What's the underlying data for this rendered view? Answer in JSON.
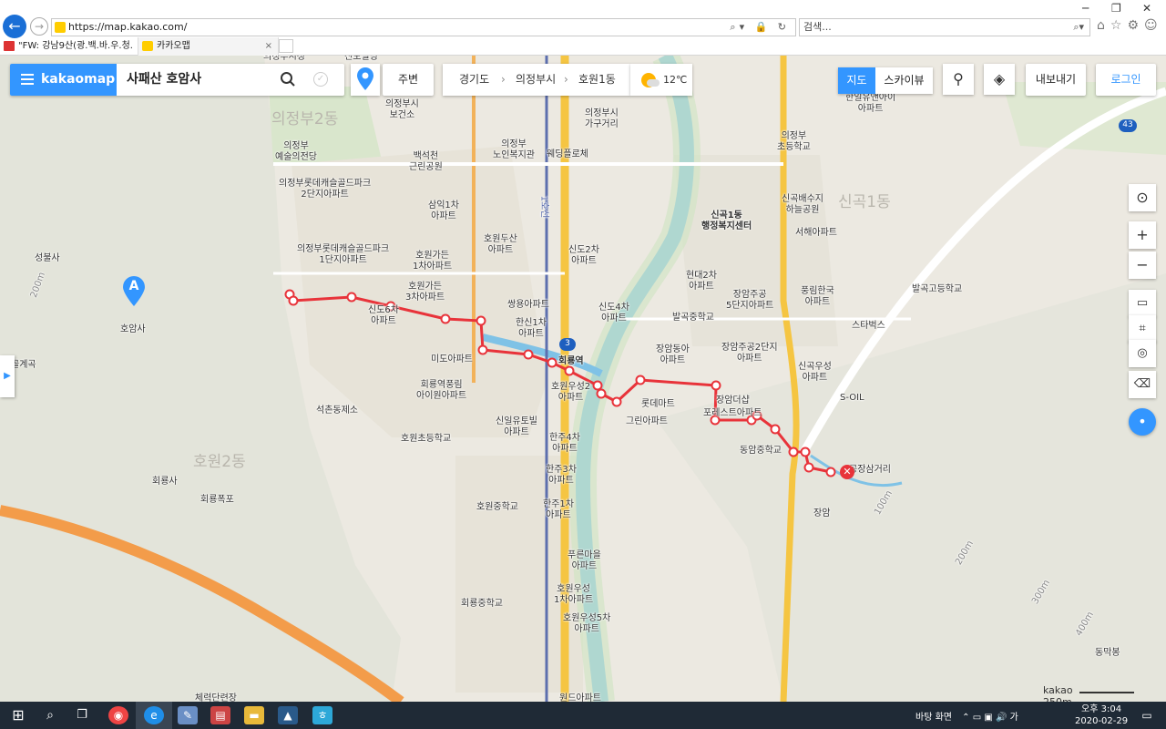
{
  "browser": {
    "url": "https://map.kakao.com/",
    "search_placeholder": "검색...",
    "tabs": [
      {
        "label": "\"FW: 강남9산(광.백.바.우.청.우..."
      },
      {
        "label": "카카오맵"
      }
    ],
    "window_controls": [
      "─",
      "❐",
      "✕"
    ]
  },
  "kakaomap": {
    "logo": "kakaomap",
    "query": "사패산 호암사",
    "nearby_button": "주변",
    "breadcrumb": [
      "경기도",
      "의정부시",
      "호원1동"
    ],
    "weather_temp": "12℃",
    "map_type": {
      "selected": "지도",
      "other": "스카이뷰"
    },
    "export_button": "내보내기",
    "login_button": "로그인",
    "start_marker": "A",
    "scale_brand": "kakao",
    "scale_distance": "250m"
  },
  "map_labels": {
    "uijeongbu_station": "의정부시청",
    "sindo_building": "신도빌딩",
    "uijeongbu_2dong": "의정부2동",
    "health_center": "의정부시\n보건소",
    "arts_hall": "의정부\n예술의전당",
    "baekseok_park": "백석천\n근린공원",
    "senior_center": "의정부\n노인복지관",
    "wedding_hall": "웨딩플로체",
    "furniture_street": "의정부시\n가구거리",
    "elem_uijeongbu": "의정부\n초등학교",
    "hanil_apt": "한일유앤아이\n아파트",
    "lotte_castle_2": "의정부롯데캐슬골드파크\n2단지아파트",
    "lotte_castle_1": "의정부롯데캐슬골드파크\n1단지아파트",
    "samik_apt": "삼익1차\n아파트",
    "howon_doosan": "호원두산\n아파트",
    "sindo2": "신도2차\n아파트",
    "sin1dong_center": "신곡1동\n행정복지센터",
    "singok_park": "신곡배수지\n하늘공원",
    "seohae_apt": "서해아파트",
    "singok_1dong": "신곡1동",
    "howon_garden_1": "호원가든\n1차아파트",
    "howon_garden_3": "호원가든\n3차아파트",
    "sindo6": "신도6차\n아파트",
    "ssangyong": "쌍용아파트",
    "hansin": "한신1차\n아파트",
    "sindo4": "신도4차\n아파트",
    "hyundai2": "현대2차\n아파트",
    "jangam_jugong5": "장암주공\n5단지아파트",
    "pungrim": "풍림한국\n아파트",
    "balgok_high": "발곡고등학교",
    "balgok_mid": "발곡중학교",
    "starbucks": "스타벅스",
    "seonggol": "성불사",
    "golgyegok": "골계곡",
    "hoamsa": "호암사",
    "mido": "미도아파트",
    "hoeryong_station": "회룡역",
    "hoeryong_apt": "회룡역풍림\n아이원아파트",
    "howon_woosung2": "호원우성2\n아파트",
    "lotte_mart": "롯데마트",
    "jangam_dong": "장암동아\n아파트",
    "jangam_2": "장암주공2단지\n아파트",
    "singok_woosung": "신곡우성\n아파트",
    "s_oil": "S-OIL",
    "jangam_dsp": "장암더샵",
    "pores": "포레스트아파트",
    "green_apt": "그린아파트",
    "seokcheon": "석촌동제소",
    "howon_elem": "호원초등학교",
    "sinil": "신일유토빌\n아파트",
    "hanju4": "한주4차\n아파트",
    "hanju3": "한주3차\n아파트",
    "hanju1": "한주1차\n아파트",
    "dongam_mid": "동암중학교",
    "howon_2dong": "호원2동",
    "hoeryongsa": "회룡사",
    "hoeryong_falls": "회룡폭포",
    "howon_mid": "호원중학교",
    "pureun": "푸른마을\n아파트",
    "howon_woosung1": "호원우성\n1차아파트",
    "howon_woosung5": "호원우성5차\n아파트",
    "hoeryong_mid": "회룡중학교",
    "jangam_ic": "장암",
    "gongsam": "공장삼거리",
    "dongmakbong": "동막봉",
    "wondeu": "원드아파트",
    "cheryeok": "체력단련장",
    "road_3": "3",
    "road_43": "43",
    "contour_200": "200m",
    "contour_300": "300m",
    "contour_400": "400m",
    "contour_100": "100m",
    "contour_200b": "200m",
    "line_1": "1호선"
  },
  "taskbar": {
    "desktop_label": "바탕 화면",
    "time_label": "오후 3:04",
    "date_label": "2020-02-29"
  },
  "colors": {
    "accent": "#3396ff",
    "route": "#e8333a",
    "river": "#7fc2e6",
    "park": "#cfe5c2",
    "highway": "#f5c542"
  }
}
